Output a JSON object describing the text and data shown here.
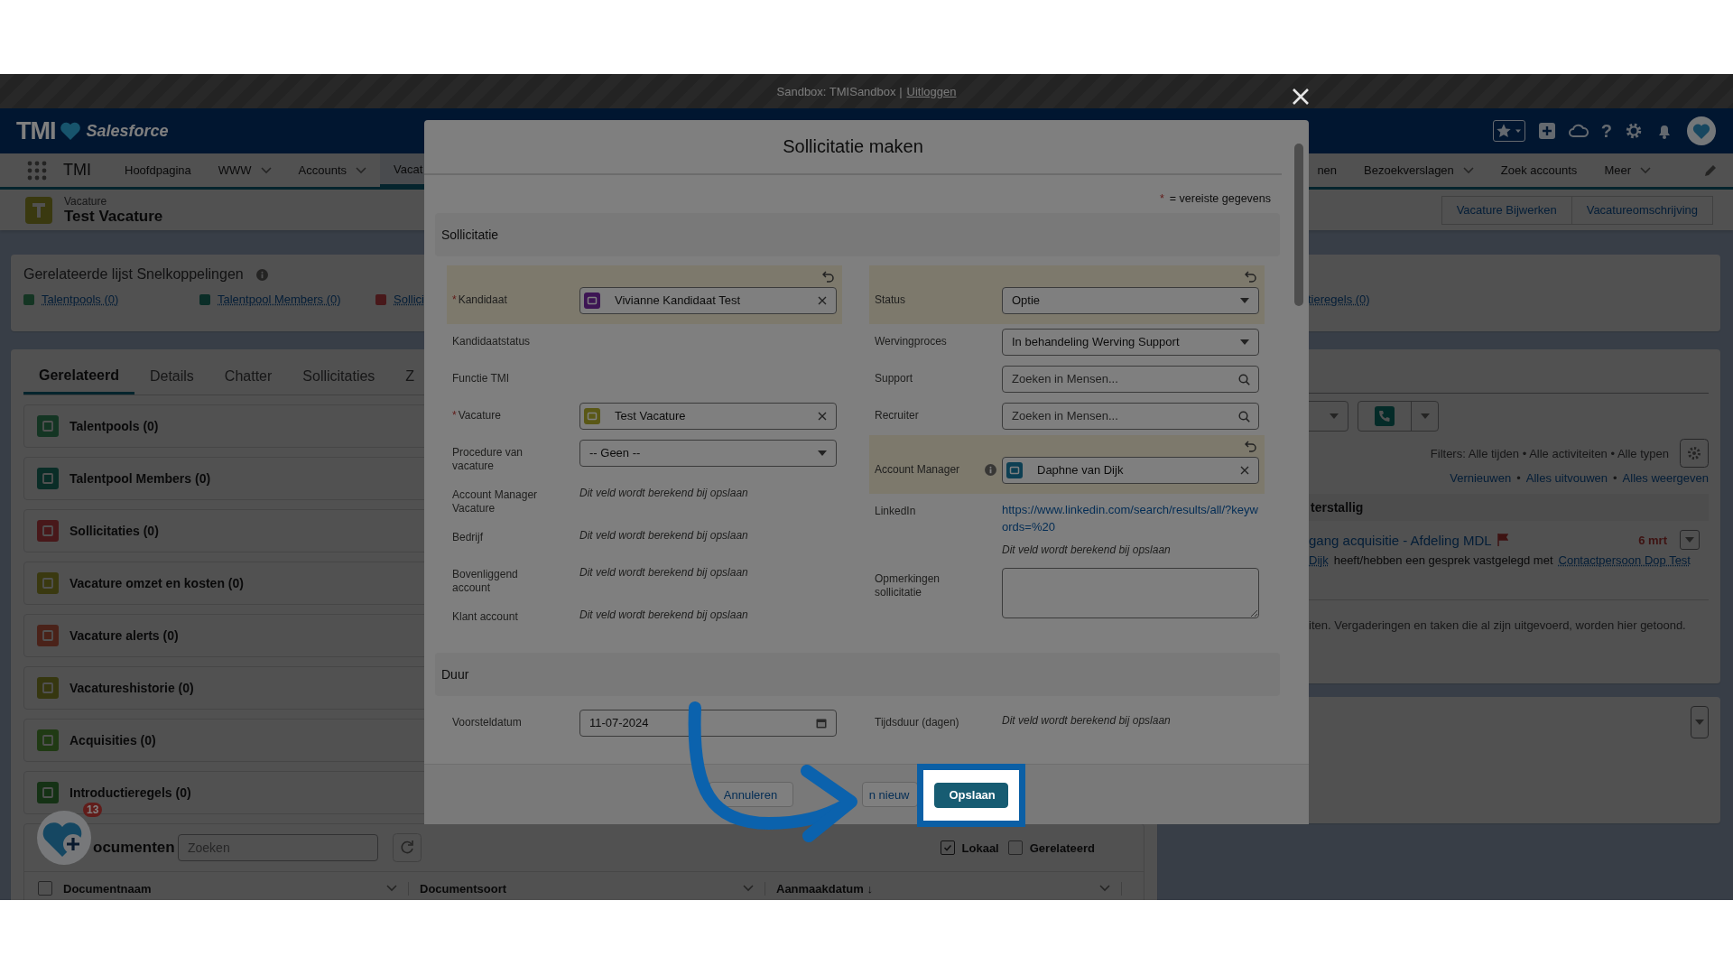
{
  "sandbox_bar": {
    "text": "Sandbox: TMISandbox |",
    "link": "Uitloggen"
  },
  "header": {
    "logo": "TMI",
    "brand": "Salesforce",
    "help": "?"
  },
  "nav": {
    "app_name": "TMI",
    "items": [
      {
        "label": "Hoofdpagina",
        "dropdown": false,
        "selected": false
      },
      {
        "label": "WWW",
        "dropdown": true,
        "selected": false
      },
      {
        "label": "Accounts",
        "dropdown": true,
        "selected": false
      },
      {
        "label": "Vacat",
        "dropdown": false,
        "selected": true
      }
    ],
    "right_items": [
      {
        "label": "nen",
        "dropdown": false,
        "selected": false
      },
      {
        "label": "Bezoekverslagen",
        "dropdown": true,
        "selected": false
      },
      {
        "label": "Zoek accounts",
        "dropdown": false,
        "selected": false
      },
      {
        "label": "Meer",
        "dropdown": true,
        "selected": false
      }
    ]
  },
  "record": {
    "type": "Vacature",
    "title": "Test Vacature",
    "color": "#3a3910",
    "actions": [
      "Vacature Bijwerken",
      "Vacatureomschrijving"
    ]
  },
  "quick_links": {
    "title": "Gerelateerde lijst Snelkoppelingen",
    "links": [
      {
        "label": "Talentpools (0)",
        "color": "#143523"
      },
      {
        "label": "Talentpool Members (0)",
        "color": "#0a2d27"
      },
      {
        "label": "Sollici",
        "color": "#48181a"
      }
    ],
    "right_links": [
      {
        "label": "tieregels (0)"
      }
    ]
  },
  "tabs": [
    {
      "label": "Gerelateerd",
      "selected": true
    },
    {
      "label": "Details",
      "selected": false
    },
    {
      "label": "Chatter",
      "selected": false
    },
    {
      "label": "Sollicitaties",
      "selected": false
    },
    {
      "label": "Z",
      "selected": false
    }
  ],
  "related_lists": [
    {
      "label": "Talentpools (0)",
      "color": "#143523"
    },
    {
      "label": "Talentpool Members (0)",
      "color": "#0a2d27"
    },
    {
      "label": "Sollicitaties (0)",
      "color": "#48181a"
    },
    {
      "label": "Vacature omzet en kosten (0)",
      "color": "#3a3910"
    },
    {
      "label": "Vacature alerts (0)",
      "color": "#4a2219"
    },
    {
      "label": "Vacatureshistorie (0)",
      "color": "#363710"
    },
    {
      "label": "Acquisities (0)",
      "color": "#203a14"
    },
    {
      "label": "Introductieregels (0)",
      "color": "#153215"
    }
  ],
  "documents": {
    "title": "ocumenten",
    "search_placeholder": "Zoeken",
    "filters": [
      {
        "label": "Lokaal",
        "checked": true
      },
      {
        "label": "Gerelateerd",
        "checked": false
      }
    ],
    "select_all": {
      "checked": false
    },
    "columns": [
      {
        "label": "Documentnaam"
      },
      {
        "label": "Documentsoort"
      },
      {
        "label": "Aanmaakdatum ↓"
      }
    ]
  },
  "floating_badge": {
    "count": "13"
  },
  "activity": {
    "filters": "Filters: Alle tijden • Alle activiteiten • Alle typen",
    "actions": [
      "Vernieuwen",
      "Alles uitvouwen",
      "Alles weergeven"
    ],
    "separator": "•",
    "group_title": "terstallig",
    "item": {
      "title": "gang acquisitie - Afdeling MDL",
      "date": "6 mrt",
      "actor": "Dijk",
      "text": "heeft/hebben een gesprek vastgelegd met",
      "contact": "Contactpersoon Dop Test"
    },
    "footer_text": "iten. Vergaderingen en taken die al zijn uitgevoerd, worden hier getoond."
  },
  "modal": {
    "title": "Sollicitatie maken",
    "required_mark": "*",
    "required_note": "= vereiste gegevens",
    "sections": [
      {
        "title": "Sollicitatie",
        "left": [
          {
            "label": "Kandidaat",
            "required": true,
            "changed": true,
            "kind": "lookup",
            "value": "Vivianne Kandidaat Test",
            "color": "#3d1554"
          },
          {
            "label": "Kandidaatstatus",
            "required": false,
            "changed": false,
            "kind": "empty"
          },
          {
            "label": "Functie TMI",
            "required": false,
            "changed": false,
            "kind": "empty"
          },
          {
            "label": "Vacature",
            "required": true,
            "changed": false,
            "kind": "lookup",
            "value": "Test Vacature",
            "color": "#5a5816"
          },
          {
            "label": "Procedure van vacature",
            "required": false,
            "changed": false,
            "kind": "picklist",
            "value": "-- Geen --"
          },
          {
            "label": "Account Manager Vacature",
            "required": false,
            "changed": false,
            "kind": "computed",
            "value": "Dit veld wordt berekend bij opslaan"
          },
          {
            "label": "Bedrijf",
            "required": false,
            "changed": false,
            "kind": "computed",
            "value": "Dit veld wordt berekend bij opslaan"
          },
          {
            "label": "Bovenliggend account",
            "required": false,
            "changed": false,
            "kind": "computed",
            "value": "Dit veld wordt berekend bij opslaan"
          },
          {
            "label": "Klant account",
            "required": false,
            "changed": false,
            "kind": "computed",
            "value": "Dit veld wordt berekend bij opslaan"
          }
        ],
        "right": [
          {
            "label": "Status",
            "required": false,
            "changed": true,
            "kind": "picklist",
            "value": "Optie"
          },
          {
            "label": "Wervingproces",
            "required": false,
            "changed": false,
            "kind": "picklist",
            "value": "In behandeling Werving Support"
          },
          {
            "label": "Support",
            "required": false,
            "changed": false,
            "kind": "search",
            "placeholder": "Zoeken in Mensen..."
          },
          {
            "label": "Recruiter",
            "required": false,
            "changed": false,
            "kind": "search",
            "placeholder": "Zoeken in Mensen..."
          },
          {
            "label": "Account Manager",
            "required": false,
            "changed": true,
            "info": true,
            "kind": "lookup",
            "value": "Daphne van Dijk",
            "color": "#0d3f53"
          },
          {
            "label": "LinkedIn",
            "required": false,
            "changed": false,
            "kind": "link",
            "value": "https://www.linkedin.com/search/results/all/?keywords=%20",
            "note": "Dit veld wordt berekend bij opslaan"
          },
          {
            "label": "Opmerkingen sollicitatie",
            "required": false,
            "changed": false,
            "kind": "textarea"
          }
        ]
      },
      {
        "title": "Duur",
        "left": [
          {
            "label": "Voorsteldatum",
            "required": false,
            "changed": false,
            "kind": "date",
            "value": "11-07-2024"
          }
        ],
        "right": [
          {
            "label": "Tijdsduur (dagen)",
            "required": false,
            "changed": false,
            "kind": "computed",
            "value": "Dit veld wordt berekend bij opslaan"
          }
        ]
      }
    ],
    "buttons": [
      {
        "label": "Annuleren",
        "kind": "neutral",
        "highlighted": false
      },
      {
        "label": "n nieuw",
        "kind": "partial",
        "highlighted": false
      },
      {
        "label": "Opslaan",
        "kind": "primary",
        "highlighted": true
      }
    ]
  }
}
